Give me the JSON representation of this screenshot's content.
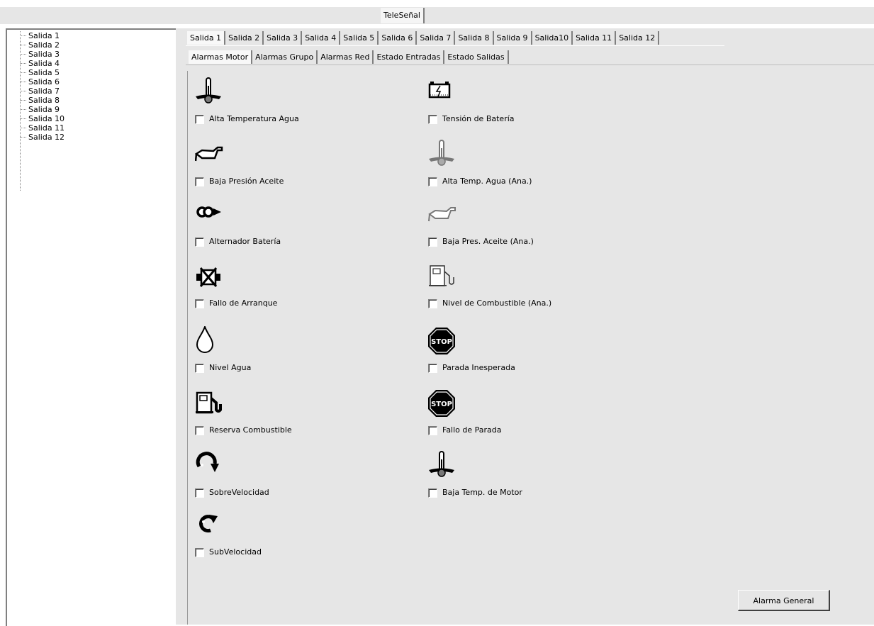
{
  "window": {
    "title_tab": "TeleSeñal"
  },
  "tree": {
    "items": [
      "Salida 1",
      "Salida 2",
      "Salida 3",
      "Salida 4",
      "Salida 5",
      "Salida 6",
      "Salida 7",
      "Salida 8",
      "Salida 9",
      "Salida 10",
      "Salida 11",
      "Salida 12"
    ]
  },
  "output_tabs": [
    "Salida 1",
    "Salida 2",
    "Salida 3",
    "Salida 4",
    "Salida 5",
    "Salida 6",
    "Salida 7",
    "Salida 8",
    "Salida 9",
    "Salida10",
    "Salida 11",
    "Salida 12"
  ],
  "category_tabs": [
    "Alarmas Motor",
    "Alarmas Grupo",
    "Alarmas Red",
    "Estado Entradas",
    "Estado Salidas"
  ],
  "alarms": [
    {
      "label": "Alta Temperatura  Agua",
      "icon": "thermometer-icon",
      "checked": false
    },
    {
      "label": "Tensión de Batería",
      "icon": "battery-icon",
      "checked": false
    },
    {
      "label": "Baja Presión Aceite",
      "icon": "oil-can-icon",
      "checked": false
    },
    {
      "label": "Alta Temp. Agua (Ana.)",
      "icon": "thermometer-icon",
      "checked": false
    },
    {
      "label": "Alternador Batería",
      "icon": "alternator-icon",
      "checked": false
    },
    {
      "label": "Baja Pres. Aceite (Ana.)",
      "icon": "oil-can-icon",
      "checked": false
    },
    {
      "label": "Fallo de Arranque",
      "icon": "starter-motor-icon",
      "checked": false
    },
    {
      "label": "Nivel de Combustible (Ana.)",
      "icon": "fuel-pump-icon",
      "checked": false
    },
    {
      "label": "Nivel Agua",
      "icon": "water-drop-icon",
      "checked": false
    },
    {
      "label": "Parada Inesperada",
      "icon": "stop-sign-icon",
      "checked": false
    },
    {
      "label": "Reserva Combustible",
      "icon": "fuel-pump-icon",
      "checked": false
    },
    {
      "label": "Fallo de Parada",
      "icon": "stop-sign-icon",
      "checked": false
    },
    {
      "label": "SobreVelocidad",
      "icon": "overspeed-arrow-icon",
      "checked": false
    },
    {
      "label": "Baja Temp. de Motor",
      "icon": "thermometer-icon",
      "checked": false
    },
    {
      "label": "SubVelocidad",
      "icon": "underspeed-arrow-icon",
      "checked": false
    }
  ],
  "buttons": {
    "general_alarm": "Alarma General"
  },
  "icons": {
    "stop_text": "STOP"
  },
  "colors": {
    "background": "#e6e6e6",
    "tab_active": "#f8f8f8",
    "border_dark": "#808080"
  }
}
